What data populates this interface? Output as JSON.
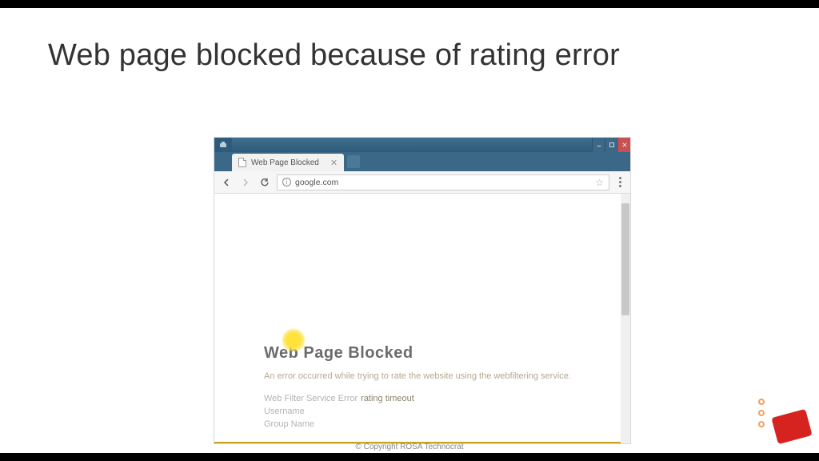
{
  "slide": {
    "title": "Web page blocked because of rating error",
    "footer": "© Copyright ROSA Technocrat"
  },
  "browser": {
    "tab_title": "Web Page Blocked",
    "url": "google.com"
  },
  "blocked": {
    "heading": "Web Page Blocked",
    "message": "An error occurred while trying to rate the website using the webfiltering service.",
    "details": [
      {
        "label": "Web Filter Service Error",
        "value": "rating timeout"
      },
      {
        "label": "Username",
        "value": ""
      },
      {
        "label": "Group Name",
        "value": ""
      }
    ]
  }
}
